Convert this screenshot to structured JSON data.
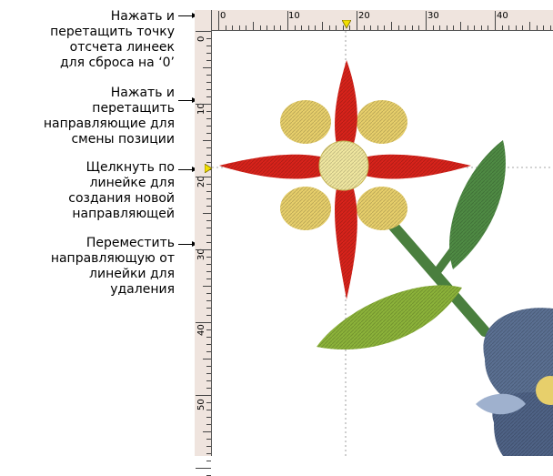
{
  "callouts": [
    {
      "lines": [
        "Нажать и",
        "перетащить точку",
        "отсчета линеек",
        "для сброса на ‘0’"
      ]
    },
    {
      "lines": [
        "Нажать и",
        "перетащить",
        "направляющие для",
        "смены позиции"
      ]
    },
    {
      "lines": [
        "Щелкнуть по",
        "линейке для",
        "создания новой",
        "направляющей"
      ]
    },
    {
      "lines": [
        "Переместить",
        "направляющую от",
        "линейки для",
        "удаления"
      ]
    }
  ],
  "ruler_h_labels": [
    "0",
    "10",
    "20",
    "30",
    "40"
  ],
  "ruler_v_labels": [
    "0",
    "10",
    "20",
    "30",
    "40",
    "50"
  ],
  "colors": {
    "ruler_bg": "#efe4de",
    "guide_marker": "#f2e000",
    "petal_red": "#d8231b",
    "petal_yellow": "#e7cf6b",
    "flower_center": "#f0e7a0",
    "stem_green": "#4a7f3e",
    "leaf_light_green": "#8cb33a",
    "leaf_dark_green": "#4f8b44",
    "blue_flower": "#5b7092"
  }
}
